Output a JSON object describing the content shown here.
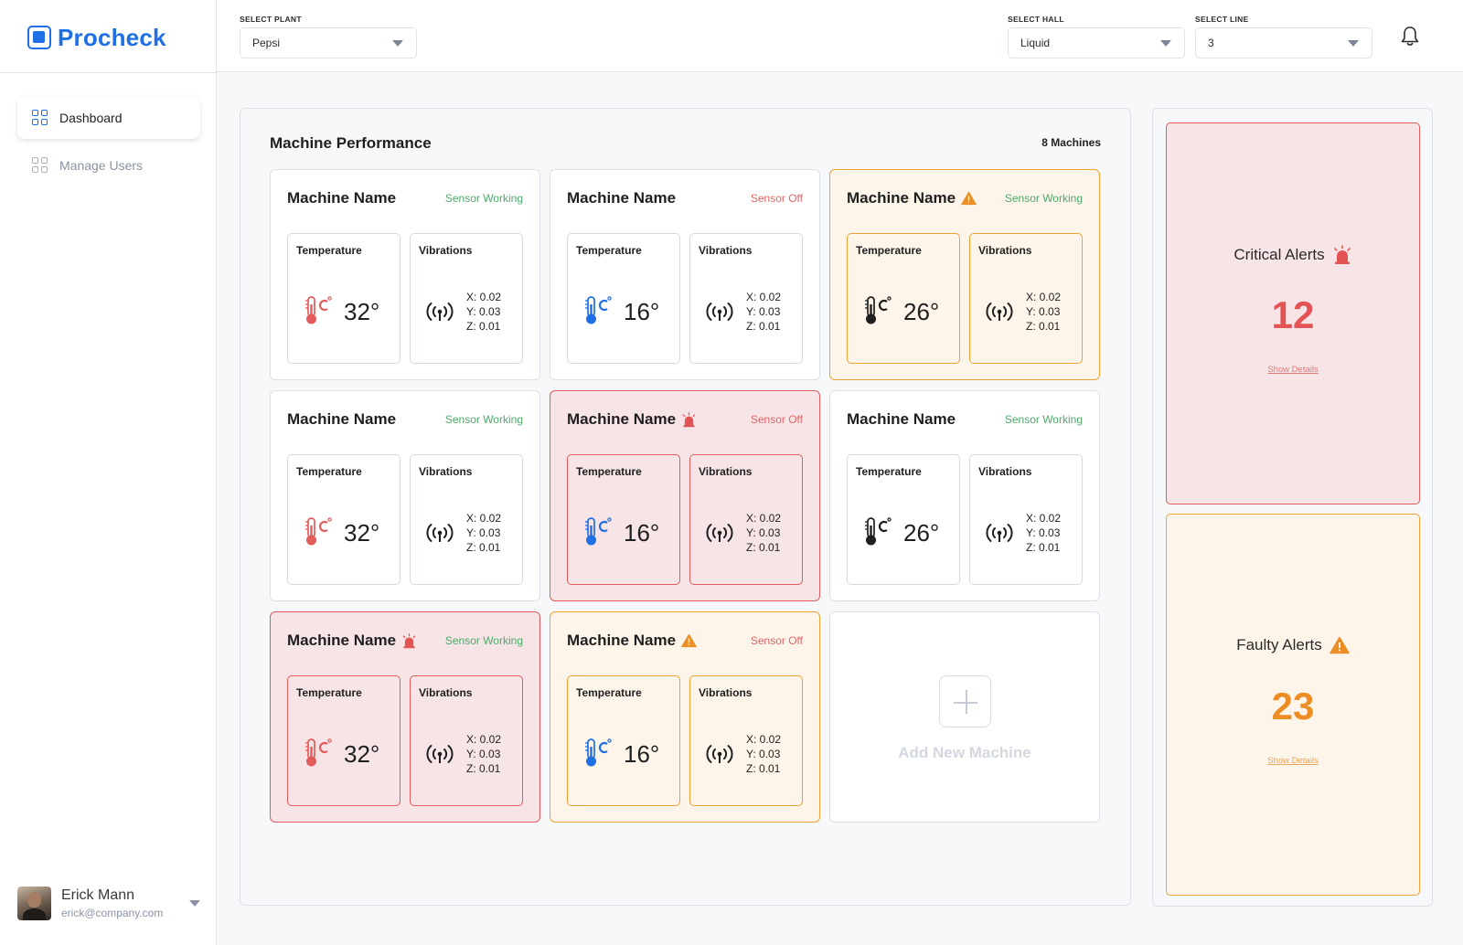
{
  "app": {
    "name": "Procheck"
  },
  "sidebar": {
    "items": [
      {
        "label": "Dashboard",
        "active": true
      },
      {
        "label": "Manage Users",
        "active": false
      }
    ],
    "user": {
      "name": "Erick Mann",
      "email": "erick@company.com"
    }
  },
  "filters": {
    "plant": {
      "label": "SELECT PLANT",
      "value": "Pepsi"
    },
    "hall": {
      "label": "SELECT HALL",
      "value": "Liquid"
    },
    "line": {
      "label": "SELECT LINE",
      "value": "3"
    }
  },
  "performance": {
    "title": "Machine Performance",
    "count": "8 Machines",
    "temperature_label": "Temperature",
    "vibration_label": "Vibrations",
    "machines": [
      {
        "name": "Machine Name",
        "status": "Sensor Working",
        "level": "normal",
        "temp": "32°",
        "thermo_color": "#e35b5b",
        "vib": [
          "X: 0.02",
          "Y: 0.03",
          "Z: 0.01"
        ]
      },
      {
        "name": "Machine Name",
        "status": "Sensor Off",
        "level": "normal",
        "temp": "16°",
        "thermo_color": "#1f6fe5",
        "vib": [
          "X: 0.02",
          "Y: 0.03",
          "Z: 0.01"
        ]
      },
      {
        "name": "Machine Name",
        "status": "Sensor Working",
        "level": "warning",
        "temp": "26°",
        "thermo_color": "#1f1f1f",
        "vib": [
          "X: 0.02",
          "Y: 0.03",
          "Z: 0.01"
        ]
      },
      {
        "name": "Machine Name",
        "status": "Sensor Working",
        "level": "normal",
        "temp": "32°",
        "thermo_color": "#e35b5b",
        "vib": [
          "X: 0.02",
          "Y: 0.03",
          "Z: 0.01"
        ]
      },
      {
        "name": "Machine Name",
        "status": "Sensor Off",
        "level": "critical",
        "temp": "16°",
        "thermo_color": "#1f6fe5",
        "vib": [
          "X: 0.02",
          "Y: 0.03",
          "Z: 0.01"
        ]
      },
      {
        "name": "Machine Name",
        "status": "Sensor Working",
        "level": "normal",
        "temp": "26°",
        "thermo_color": "#1f1f1f",
        "vib": [
          "X: 0.02",
          "Y: 0.03",
          "Z: 0.01"
        ]
      },
      {
        "name": "Machine Name",
        "status": "Sensor Working",
        "level": "critical",
        "temp": "32°",
        "thermo_color": "#e35b5b",
        "vib": [
          "X: 0.02",
          "Y: 0.03",
          "Z: 0.01"
        ]
      },
      {
        "name": "Machine Name",
        "status": "Sensor Off",
        "level": "warning",
        "temp": "16°",
        "thermo_color": "#1f6fe5",
        "vib": [
          "X: 0.02",
          "Y: 0.03",
          "Z: 0.01"
        ]
      }
    ],
    "add_label": "Add New Machine"
  },
  "alerts": {
    "critical": {
      "title": "Critical Alerts",
      "count": "12",
      "link": "Show Details",
      "color": "#e35353"
    },
    "faulty": {
      "title": "Faulty Alerts",
      "count": "23",
      "link": "Show Details",
      "color": "#ec8e24"
    }
  },
  "colors": {
    "accent": "#1f6fe5",
    "ok": "#4caa6a",
    "off": "#e06666",
    "warning": "#eda236",
    "critical": "#e35b5b"
  }
}
